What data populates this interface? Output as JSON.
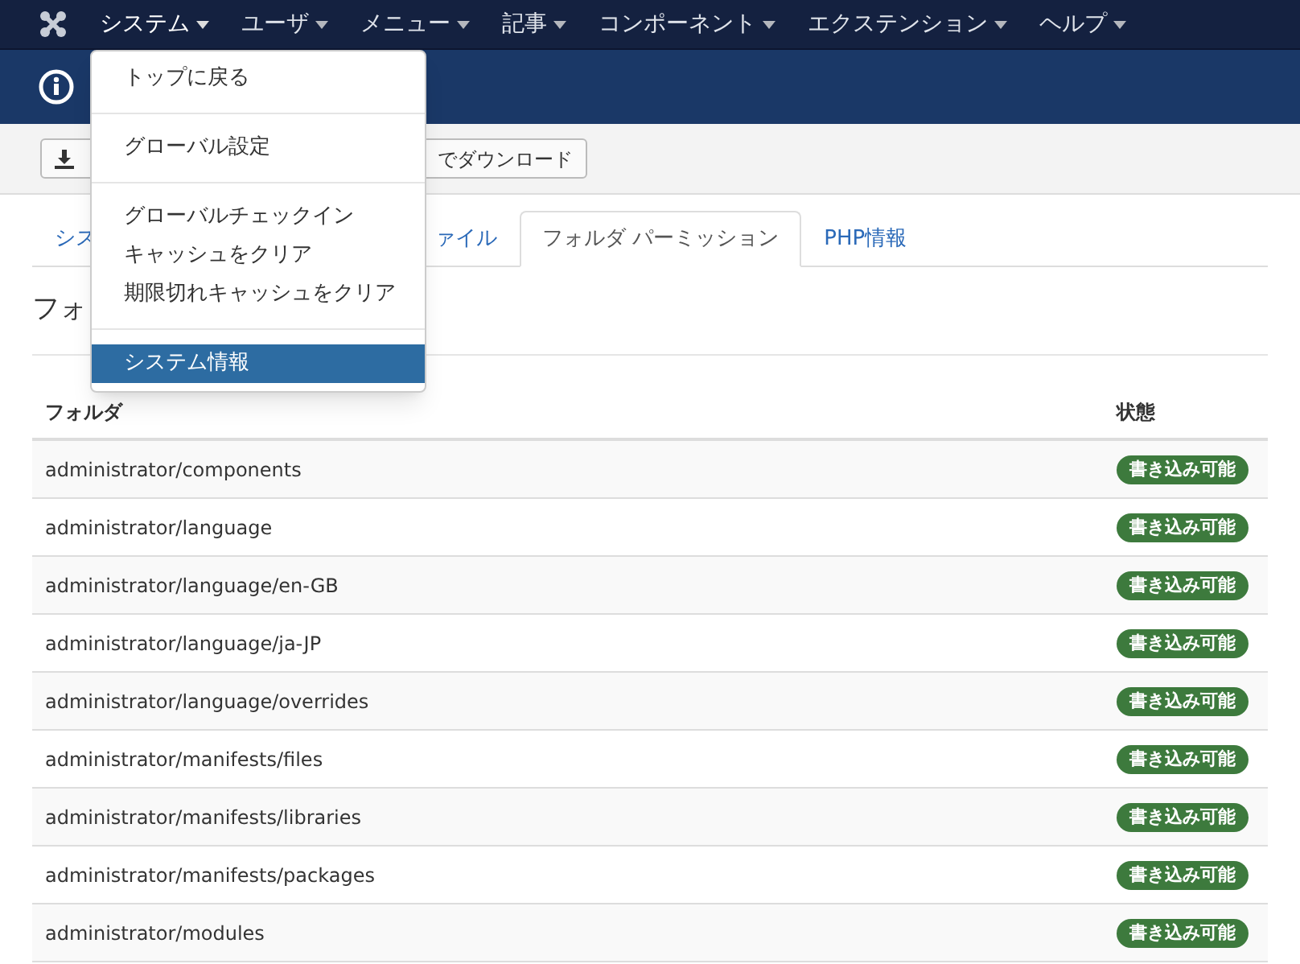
{
  "navbar": {
    "items": [
      {
        "label": "システム",
        "expanded": true
      },
      {
        "label": "ユーザ",
        "expanded": false
      },
      {
        "label": "メニュー",
        "expanded": false
      },
      {
        "label": "記事",
        "expanded": false
      },
      {
        "label": "コンポーネント",
        "expanded": false
      },
      {
        "label": "エクステンション",
        "expanded": false
      },
      {
        "label": "ヘルプ",
        "expanded": false
      }
    ]
  },
  "toolbar": {
    "download_button": "でダウンロード"
  },
  "tabs": [
    {
      "label": "シス",
      "selected": false
    },
    {
      "label": "ァイル",
      "selected": false
    },
    {
      "label": "フォルダ パーミッション",
      "selected": true
    },
    {
      "label": "PHP情報",
      "selected": false
    }
  ],
  "heading": "フォ",
  "table": {
    "columns": [
      "フォルダ",
      "状態"
    ],
    "rows": [
      {
        "folder": "administrator/components",
        "status": "書き込み可能"
      },
      {
        "folder": "administrator/language",
        "status": "書き込み可能"
      },
      {
        "folder": "administrator/language/en-GB",
        "status": "書き込み可能"
      },
      {
        "folder": "administrator/language/ja-JP",
        "status": "書き込み可能"
      },
      {
        "folder": "administrator/language/overrides",
        "status": "書き込み可能"
      },
      {
        "folder": "administrator/manifests/files",
        "status": "書き込み可能"
      },
      {
        "folder": "administrator/manifests/libraries",
        "status": "書き込み可能"
      },
      {
        "folder": "administrator/manifests/packages",
        "status": "書き込み可能"
      },
      {
        "folder": "administrator/modules",
        "status": "書き込み可能"
      }
    ]
  },
  "dropdown": {
    "groups": [
      [
        {
          "label": "トップに戻る",
          "selected": false
        }
      ],
      [
        {
          "label": "グローバル設定",
          "selected": false
        }
      ],
      [
        {
          "label": "グローバルチェックイン",
          "selected": false
        },
        {
          "label": "キャッシュをクリア",
          "selected": false
        },
        {
          "label": "期限切れキャッシュをクリア",
          "selected": false
        }
      ],
      [
        {
          "label": "システム情報",
          "selected": true
        }
      ]
    ]
  }
}
